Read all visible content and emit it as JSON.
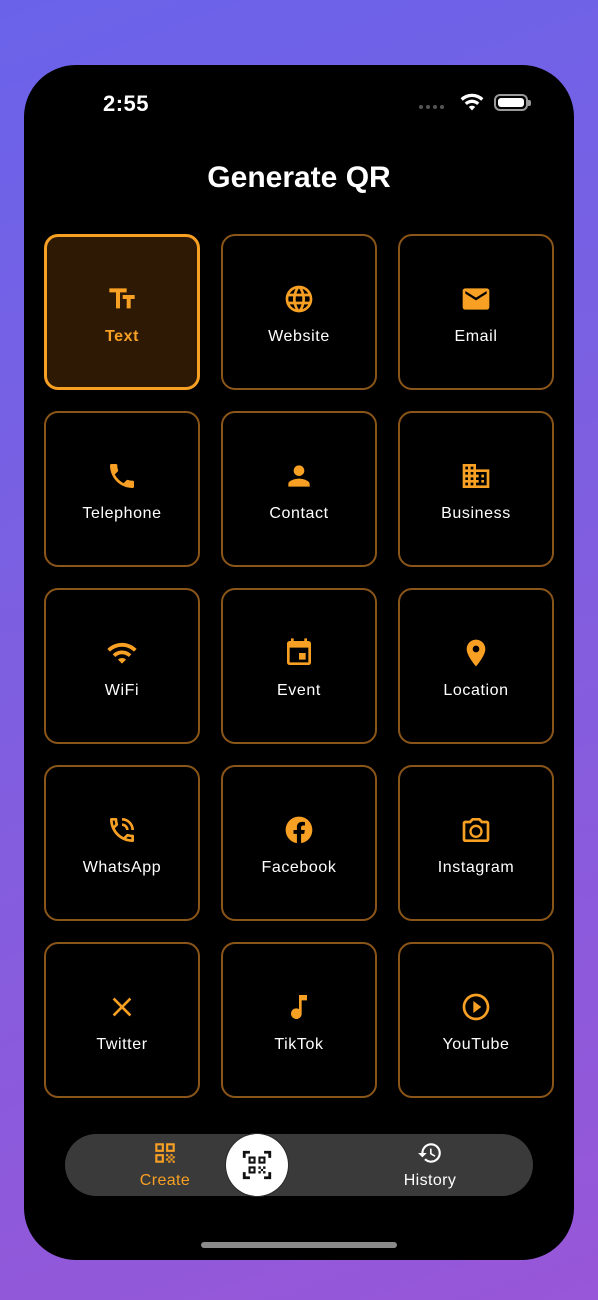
{
  "status_bar": {
    "time": "2:55"
  },
  "header": {
    "title": "Generate QR"
  },
  "colors": {
    "accent": "#f7a023",
    "tile_border": "#8a5518",
    "selected_fill": "#2e1a04",
    "background_gradient_start": "#6a63ea",
    "background_gradient_end": "#9856d8"
  },
  "grid": {
    "selected": "Text",
    "items": [
      {
        "label": "Text",
        "icon": "text-format-icon"
      },
      {
        "label": "Website",
        "icon": "globe-icon"
      },
      {
        "label": "Email",
        "icon": "envelope-icon"
      },
      {
        "label": "Telephone",
        "icon": "phone-icon"
      },
      {
        "label": "Contact",
        "icon": "person-icon"
      },
      {
        "label": "Business",
        "icon": "building-icon"
      },
      {
        "label": "WiFi",
        "icon": "wifi-icon"
      },
      {
        "label": "Event",
        "icon": "calendar-icon"
      },
      {
        "label": "Location",
        "icon": "location-pin-icon"
      },
      {
        "label": "WhatsApp",
        "icon": "phone-in-talk-icon"
      },
      {
        "label": "Facebook",
        "icon": "facebook-icon"
      },
      {
        "label": "Instagram",
        "icon": "camera-icon"
      },
      {
        "label": "Twitter",
        "icon": "x-icon"
      },
      {
        "label": "TikTok",
        "icon": "music-note-icon"
      },
      {
        "label": "YouTube",
        "icon": "play-circle-icon"
      }
    ]
  },
  "tab_bar": {
    "create_label": "Create",
    "history_label": "History",
    "active_tab": "Create"
  }
}
